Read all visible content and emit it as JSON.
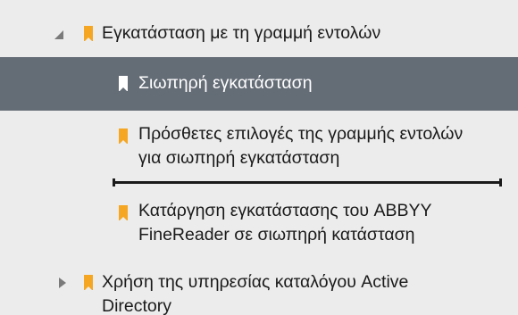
{
  "tree": {
    "nodes": [
      {
        "label": "Εγκατάσταση με τη γραμμή εντολών",
        "expanded": true,
        "icon": "bookmark-icon",
        "icon_color": "#f5a623"
      },
      {
        "label": "Σιωπηρή εγκατάσταση",
        "selected": true,
        "icon": "bookmark-icon",
        "icon_color": "#ffffff",
        "selected_bg": "#646c76"
      },
      {
        "label_lines": [
          "Πρόσθετες επιλογές της γραμμής εντολών",
          "για σιωπηρή εγκατάσταση"
        ],
        "icon": "bookmark-icon",
        "icon_color": "#f5a623"
      },
      {
        "label_lines": [
          "Κατάργηση εγκατάστασης του ABBYY",
          "FineReader σε σιωπηρή κατάσταση"
        ],
        "icon": "bookmark-icon",
        "icon_color": "#f5a623"
      },
      {
        "label_lines": [
          "Χρήση της υπηρεσίας καταλόγου Active",
          "Directory"
        ],
        "expanded": false,
        "icon": "bookmark-icon",
        "icon_color": "#f5a623"
      }
    ]
  }
}
